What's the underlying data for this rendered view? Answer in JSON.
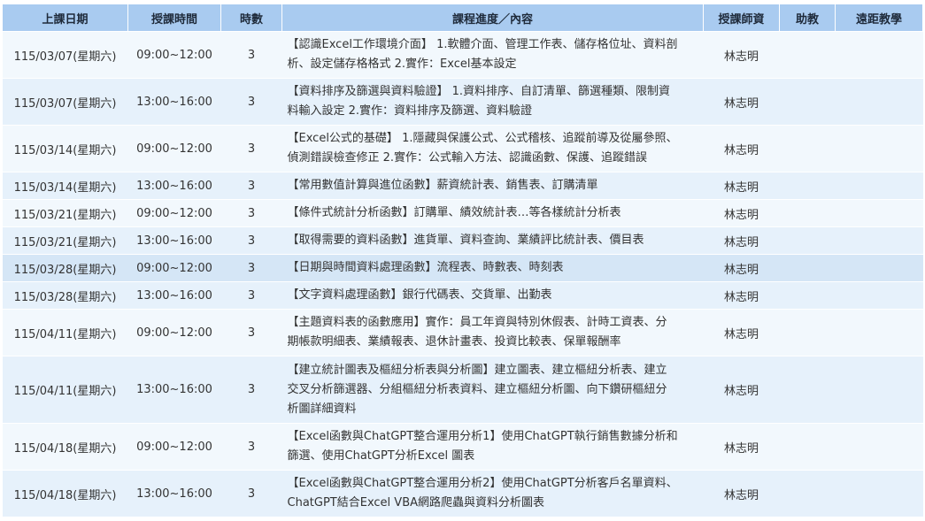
{
  "headers": [
    "上課日期",
    "授課時間",
    "時數",
    "課程進度／內容",
    "授課師資",
    "助教",
    "遠距教學"
  ],
  "rows": [
    {
      "date": "115/03/07(星期六)",
      "time": "09:00~12:00",
      "hours": "3",
      "content": [
        "【認識Excel工作環境介面】 1.軟體介面、管理工作表、儲存格位址、資料剖",
        "析、設定儲存格格式 2.實作：Excel基本設定"
      ],
      "teacher": "林志明",
      "assistant": "",
      "remote": ""
    },
    {
      "date": "115/03/07(星期六)",
      "time": "13:00~16:00",
      "hours": "3",
      "content": [
        "【資料排序及篩選與資料驗證】 1.資料排序、自訂清單、篩選種類、限制資",
        "料輸入設定 2.實作：資料排序及篩選、資料驗證"
      ],
      "teacher": "林志明",
      "assistant": "",
      "remote": ""
    },
    {
      "date": "115/03/14(星期六)",
      "time": "09:00~12:00",
      "hours": "3",
      "content": [
        "【Excel公式的基礎】 1.隱藏與保護公式、公式稽核、追蹤前導及從屬參照、",
        "偵測錯誤檢查修正 2.實作：公式輸入方法、認識函數、保護、追蹤錯誤"
      ],
      "teacher": "林志明",
      "assistant": "",
      "remote": ""
    },
    {
      "date": "115/03/14(星期六)",
      "time": "13:00~16:00",
      "hours": "3",
      "content": [
        "【常用數值計算與進位函數】薪資統計表、銷售表、訂購清單"
      ],
      "teacher": "林志明",
      "assistant": "",
      "remote": ""
    },
    {
      "date": "115/03/21(星期六)",
      "time": "09:00~12:00",
      "hours": "3",
      "content": [
        "【條件式統計分析函數】訂購單、績效統計表…等各樣統計分析表"
      ],
      "teacher": "林志明",
      "assistant": "",
      "remote": ""
    },
    {
      "date": "115/03/21(星期六)",
      "time": "13:00~16:00",
      "hours": "3",
      "content": [
        "【取得需要的資料函數】進貨單、資料查詢、業績評比統計表、價目表"
      ],
      "teacher": "林志明",
      "assistant": "",
      "remote": ""
    },
    {
      "date": "115/03/28(星期六)",
      "time": "09:00~12:00",
      "hours": "3",
      "content": [
        "【日期與時間資料處理函數】流程表、時數表、時刻表"
      ],
      "teacher": "林志明",
      "assistant": "",
      "remote": ""
    },
    {
      "date": "115/03/28(星期六)",
      "time": "13:00~16:00",
      "hours": "3",
      "content": [
        "【文字資料處理函數】銀行代碼表、交貨單、出勤表"
      ],
      "teacher": "林志明",
      "assistant": "",
      "remote": ""
    },
    {
      "date": "115/04/11(星期六)",
      "time": "09:00~12:00",
      "hours": "3",
      "content": [
        "【主題資料表的函數應用】實作：員工年資與特別休假表、計時工資表、分",
        "期帳款明細表、業績報表、退休計畫表、投資比較表、保單報酬率"
      ],
      "teacher": "林志明",
      "assistant": "",
      "remote": ""
    },
    {
      "date": "115/04/11(星期六)",
      "time": "13:00~16:00",
      "hours": "3",
      "content": [
        "【建立統計圖表及樞紐分析表與分析圖】建立圖表、建立樞紐分析表、建立",
        "交叉分析篩選器、分組樞紐分析表資料、建立樞紐分析圖、向下鑽研樞紐分",
        "析圖詳細資料"
      ],
      "teacher": "林志明",
      "assistant": "",
      "remote": ""
    },
    {
      "date": "115/04/18(星期六)",
      "time": "09:00~12:00",
      "hours": "3",
      "content": [
        "【Excel函數與ChatGPT整合運用分析1】使用ChatGPT執行銷售數據分析和",
        "篩選、使用ChatGPT分析Excel 圖表"
      ],
      "teacher": "林志明",
      "assistant": "",
      "remote": ""
    },
    {
      "date": "115/04/18(星期六)",
      "time": "13:00~16:00",
      "hours": "3",
      "content": [
        "【Excel函數與ChatGPT整合運用分析2】使用ChatGPT分析客戶名單資料、",
        "ChatGPT結合Excel VBA網路爬蟲與資料分析圖表"
      ],
      "teacher": "林志明",
      "assistant": "",
      "remote": ""
    }
  ]
}
